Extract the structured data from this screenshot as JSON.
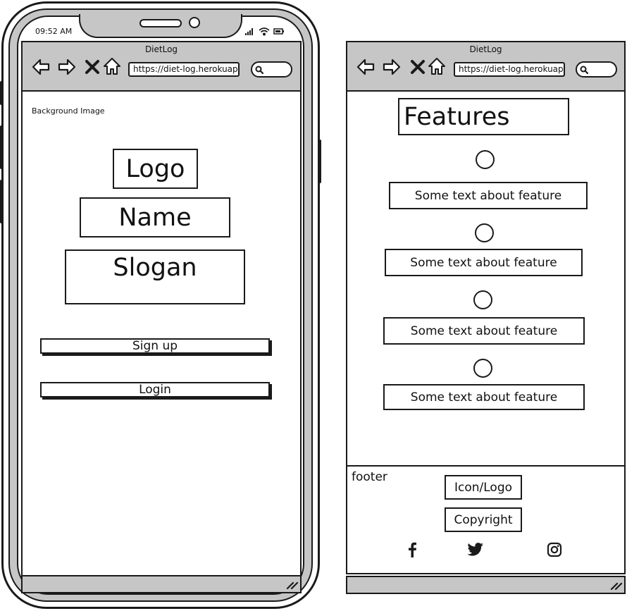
{
  "status_bar": {
    "time": "09:52 AM"
  },
  "left_browser": {
    "title": "DietLog",
    "url": "https://diet-log.herokuap",
    "background_label": "Background Image",
    "logo": "Logo",
    "name": "Name",
    "slogan": "Slogan",
    "signup_label": "Sign up",
    "login_label": "Login"
  },
  "right_browser": {
    "title": "DietLog",
    "url": "https://diet-log.herokuap",
    "features_heading": "Features",
    "features": [
      {
        "text": "Some text about feature"
      },
      {
        "text": "Some text about feature"
      },
      {
        "text": "Some text about feature"
      },
      {
        "text": "Some text about feature"
      }
    ],
    "footer": {
      "label": "footer",
      "icon_logo": "Icon/Logo",
      "copyright": "Copyright",
      "social_icons": [
        "facebook-icon",
        "twitter-icon",
        "instagram-icon"
      ]
    }
  },
  "colors": {
    "chrome_gray": "#c6c6c6",
    "ink": "#1a1a1a",
    "paper": "#ffffff"
  }
}
